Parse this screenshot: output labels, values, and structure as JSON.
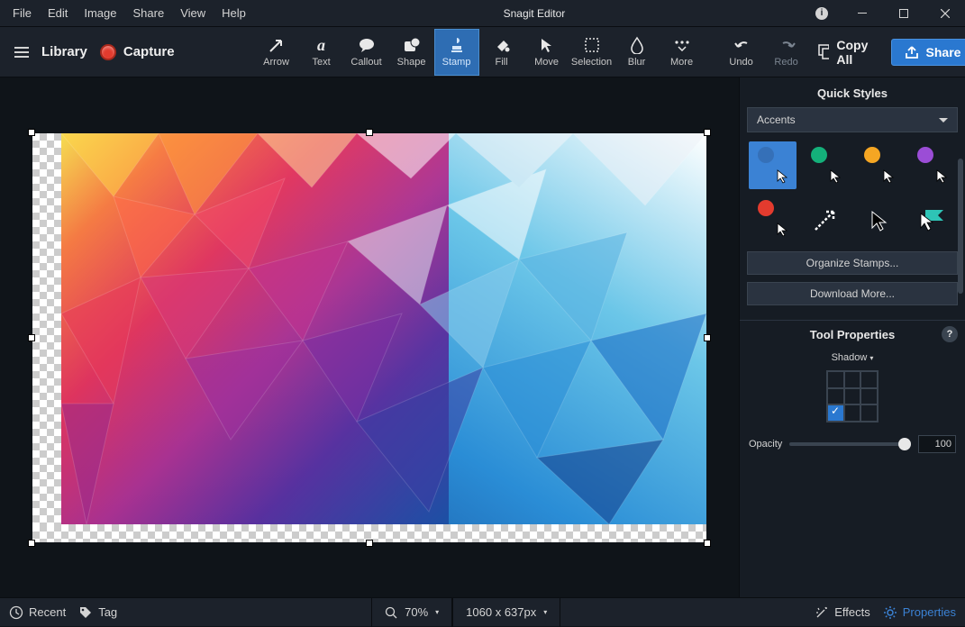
{
  "title": "Snagit Editor",
  "menu": [
    "File",
    "Edit",
    "Image",
    "Share",
    "View",
    "Help"
  ],
  "toolbar": {
    "library_label": "Library",
    "capture_label": "Capture",
    "tools": [
      {
        "id": "arrow",
        "label": "Arrow"
      },
      {
        "id": "text",
        "label": "Text"
      },
      {
        "id": "callout",
        "label": "Callout"
      },
      {
        "id": "shape",
        "label": "Shape"
      },
      {
        "id": "stamp",
        "label": "Stamp",
        "selected": true
      },
      {
        "id": "fill",
        "label": "Fill"
      },
      {
        "id": "move",
        "label": "Move"
      },
      {
        "id": "selection",
        "label": "Selection"
      },
      {
        "id": "blur",
        "label": "Blur"
      },
      {
        "id": "more",
        "label": "More"
      }
    ],
    "undo_label": "Undo",
    "redo_label": "Redo",
    "copyall_label": "Copy All",
    "share_label": "Share"
  },
  "quickstyles": {
    "title": "Quick Styles",
    "category": "Accents",
    "stamps": [
      {
        "color": "#3b82d4",
        "selected": true
      },
      {
        "color": "#14b07a"
      },
      {
        "color": "#f5a623"
      },
      {
        "color": "#9b4dd6"
      },
      {
        "color": "#e33b2e"
      },
      {
        "color": null,
        "variant": "arrow-dashed"
      },
      {
        "color": null,
        "variant": "arrow-black"
      },
      {
        "color": "#2ec4b6",
        "variant": "arrow-teal"
      }
    ],
    "organize_label": "Organize Stamps...",
    "download_label": "Download More..."
  },
  "toolprops": {
    "title": "Tool Properties",
    "shadow_label": "Shadow",
    "shadow_checked_cell": 7,
    "opacity_label": "Opacity",
    "opacity_value": "100"
  },
  "statusbar": {
    "recent_label": "Recent",
    "tag_label": "Tag",
    "zoom": "70%",
    "dimensions": "1060 x 637px",
    "effects_label": "Effects",
    "properties_label": "Properties"
  }
}
